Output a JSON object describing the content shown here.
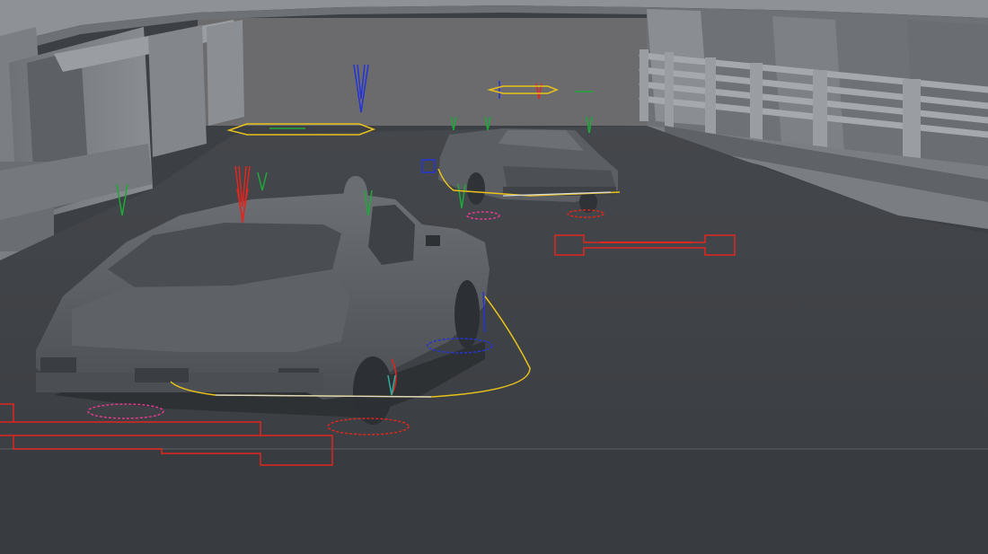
{
  "viewport": {
    "colors": {
      "sky": "#6a6a6c",
      "ceiling": "#8a8c8f",
      "wall": "#7f8286",
      "wall_dark": "#5e6165",
      "floor": "#3d4044",
      "floor_lower": "#383b3e",
      "car_body": "#5a5d61",
      "car_dark": "#3a3c40",
      "car_light": "#72757a",
      "rig_red": "#e0261e",
      "rig_green": "#1fa83a",
      "rig_blue": "#2433d8",
      "rig_yellow": "#e8c21a",
      "rig_magenta": "#e03a8c",
      "rig_white": "#d9d9d9",
      "rig_cyan": "#2ab0a0"
    },
    "objects": [
      {
        "name": "parking-structure",
        "kind": "environment"
      },
      {
        "name": "car-front",
        "kind": "rigged-vehicle"
      },
      {
        "name": "car-rear",
        "kind": "rigged-vehicle"
      },
      {
        "name": "guard-rail",
        "kind": "environment"
      }
    ]
  }
}
